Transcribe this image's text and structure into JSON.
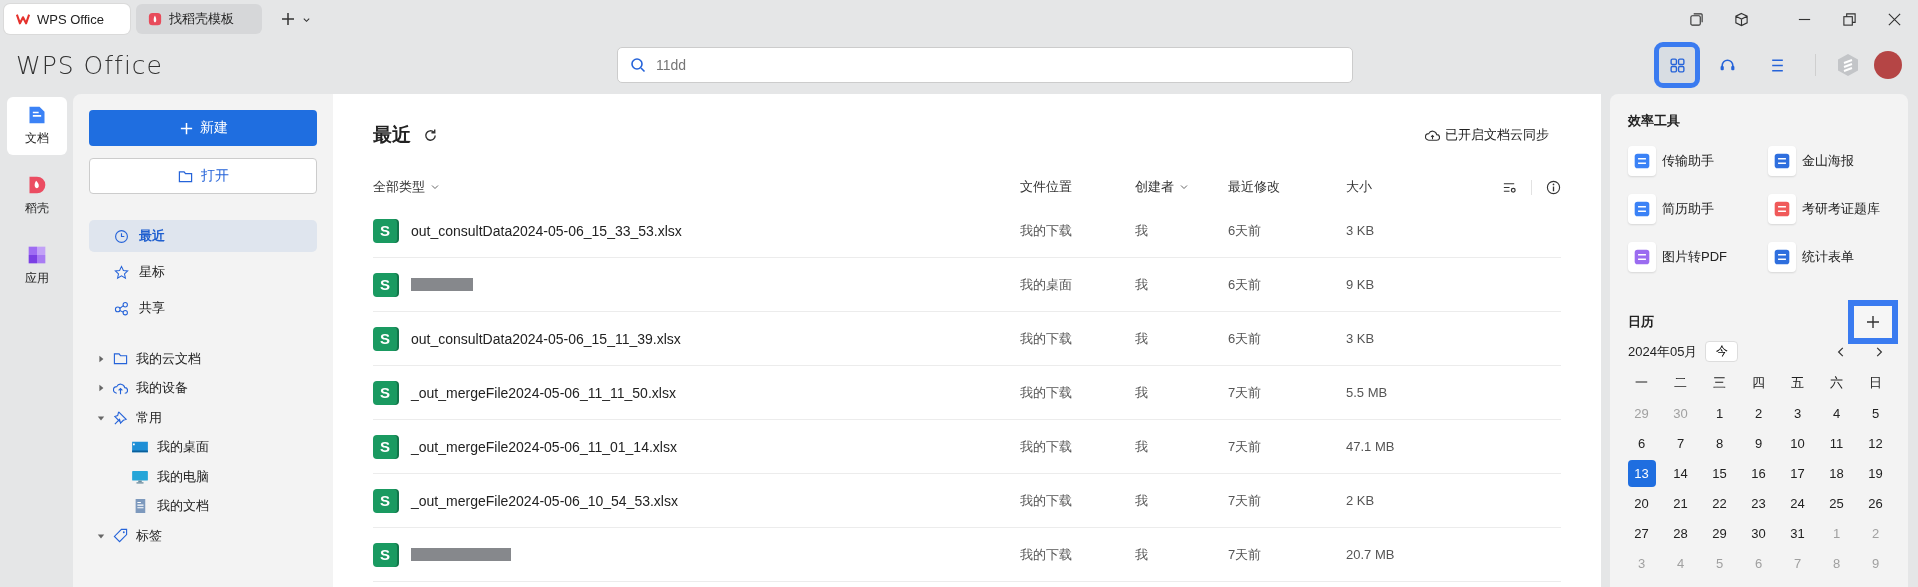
{
  "tabs": [
    {
      "label": "WPS Office",
      "selected": true
    },
    {
      "label": "找稻壳模板",
      "selected": false
    }
  ],
  "header": {
    "logo": "WPS Office",
    "search": {
      "placeholder": "11dd"
    },
    "toolbar": [
      {
        "highlighted": true
      },
      {
        "highlighted": false
      },
      {
        "highlighted": false
      }
    ]
  },
  "rail": [
    {
      "label": "文档",
      "selected": true
    },
    {
      "label": "稻壳",
      "selected": false
    },
    {
      "label": "应用",
      "selected": false
    }
  ],
  "nav": {
    "new_button": "新建",
    "open_button": "打开",
    "quick": [
      {
        "label": "最近",
        "selected": true
      },
      {
        "label": "星标",
        "selected": false
      },
      {
        "label": "共享",
        "selected": false
      }
    ],
    "tree": [
      {
        "label": "我的云文档",
        "expanded": false
      },
      {
        "label": "我的设备",
        "expanded": false
      },
      {
        "label": "常用",
        "expanded": true,
        "children": [
          {
            "label": "我的桌面"
          },
          {
            "label": "我的电脑"
          },
          {
            "label": "我的文档"
          }
        ]
      },
      {
        "label": "标签",
        "expanded": true
      }
    ]
  },
  "main": {
    "title": "最近",
    "sync": "已开启文档云同步",
    "columns": [
      {
        "label": "全部类型",
        "dropdown": true
      },
      {
        "label": "文件位置",
        "dropdown": false
      },
      {
        "label": "创建者",
        "dropdown": true
      },
      {
        "label": "最近修改",
        "dropdown": false
      },
      {
        "label": "大小",
        "dropdown": false
      }
    ],
    "rows": [
      {
        "icon_letter": "S",
        "redacted": false,
        "name": "out_consultData2024-05-06_15_33_53.xlsx",
        "location": "我的下载",
        "creator": "我",
        "modified": "6天前",
        "size": "3 KB"
      },
      {
        "icon_letter": "S",
        "redacted": true,
        "location": "我的桌面",
        "creator": "我",
        "modified": "6天前",
        "size": "9 KB"
      },
      {
        "icon_letter": "S",
        "redacted": false,
        "name": "out_consultData2024-05-06_15_11_39.xlsx",
        "location": "我的下载",
        "creator": "我",
        "modified": "6天前",
        "size": "3 KB"
      },
      {
        "icon_letter": "S",
        "redacted": false,
        "name": "_out_mergeFile2024-05-06_11_11_50.xlsx",
        "location": "我的下载",
        "creator": "我",
        "modified": "7天前",
        "size": "5.5 MB"
      },
      {
        "icon_letter": "S",
        "redacted": false,
        "name": "_out_mergeFile2024-05-06_11_01_14.xlsx",
        "location": "我的下载",
        "creator": "我",
        "modified": "7天前",
        "size": "47.1 MB"
      },
      {
        "icon_letter": "S",
        "redacted": false,
        "name": "_out_mergeFile2024-05-06_10_54_53.xlsx",
        "location": "我的下载",
        "creator": "我",
        "modified": "7天前",
        "size": "2 KB"
      },
      {
        "icon_letter": "S",
        "redacted": true,
        "location": "我的下载",
        "creator": "我",
        "modified": "7天前",
        "size": "20.7 MB"
      }
    ]
  },
  "tools": {
    "title": "效率工具",
    "items": [
      {
        "label": "传输助手"
      },
      {
        "label": "金山海报"
      },
      {
        "label": "简历助手"
      },
      {
        "label": "考研考证题库"
      },
      {
        "label": "图片转PDF"
      },
      {
        "label": "统计表单"
      }
    ]
  },
  "calendar": {
    "title": "日历",
    "add_highlighted": true,
    "month": "2024年05月",
    "today_button": "今",
    "weekdays": [
      "一",
      "二",
      "三",
      "四",
      "五",
      "六",
      "日"
    ],
    "weeks": [
      [
        {
          "day": "29",
          "muted": true,
          "selected": false
        },
        {
          "day": "30",
          "muted": true,
          "selected": false
        },
        {
          "day": "1",
          "muted": false,
          "selected": false
        },
        {
          "day": "2",
          "muted": false,
          "selected": false
        },
        {
          "day": "3",
          "muted": false,
          "selected": false
        },
        {
          "day": "4",
          "muted": false,
          "selected": false
        },
        {
          "day": "5",
          "muted": false,
          "selected": false
        }
      ],
      [
        {
          "day": "6",
          "muted": false,
          "selected": false
        },
        {
          "day": "7",
          "muted": false,
          "selected": false
        },
        {
          "day": "8",
          "muted": false,
          "selected": false
        },
        {
          "day": "9",
          "muted": false,
          "selected": false
        },
        {
          "day": "10",
          "muted": false,
          "selected": false
        },
        {
          "day": "11",
          "muted": false,
          "selected": false
        },
        {
          "day": "12",
          "muted": false,
          "selected": false
        }
      ],
      [
        {
          "day": "13",
          "muted": false,
          "selected": true
        },
        {
          "day": "14",
          "muted": false,
          "selected": false
        },
        {
          "day": "15",
          "muted": false,
          "selected": false
        },
        {
          "day": "16",
          "muted": false,
          "selected": false
        },
        {
          "day": "17",
          "muted": false,
          "selected": false
        },
        {
          "day": "18",
          "muted": false,
          "selected": false
        },
        {
          "day": "19",
          "muted": false,
          "selected": false
        }
      ],
      [
        {
          "day": "20",
          "muted": false,
          "selected": false
        },
        {
          "day": "21",
          "muted": false,
          "selected": false
        },
        {
          "day": "22",
          "muted": false,
          "selected": false
        },
        {
          "day": "23",
          "muted": false,
          "selected": false
        },
        {
          "day": "24",
          "muted": false,
          "selected": false
        },
        {
          "day": "25",
          "muted": false,
          "selected": false
        },
        {
          "day": "26",
          "muted": false,
          "selected": false
        }
      ],
      [
        {
          "day": "27",
          "muted": false,
          "selected": false
        },
        {
          "day": "28",
          "muted": false,
          "selected": false
        },
        {
          "day": "29",
          "muted": false,
          "selected": false
        },
        {
          "day": "30",
          "muted": false,
          "selected": false
        },
        {
          "day": "31",
          "muted": false,
          "selected": false
        },
        {
          "day": "1",
          "muted": true,
          "selected": false
        },
        {
          "day": "2",
          "muted": true,
          "selected": false
        }
      ],
      [
        {
          "day": "3",
          "muted": true,
          "selected": false
        },
        {
          "day": "4",
          "muted": true,
          "selected": false
        },
        {
          "day": "5",
          "muted": true,
          "selected": false
        },
        {
          "day": "6",
          "muted": true,
          "selected": false
        },
        {
          "day": "7",
          "muted": true,
          "selected": false
        },
        {
          "day": "8",
          "muted": true,
          "selected": false
        },
        {
          "day": "9",
          "muted": true,
          "selected": false
        }
      ]
    ]
  }
}
